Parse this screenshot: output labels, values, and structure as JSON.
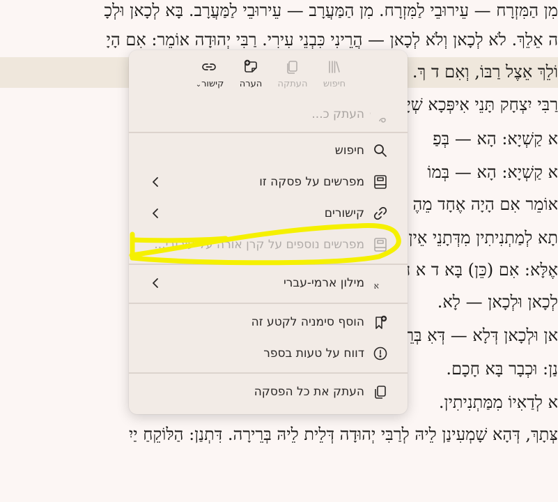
{
  "text_lines": [
    "מִן הַמִּזְרָח — עֵירוּבֵי לַמִּזְרָח. מִן הַמַּעֲרָב — עֵירוּבֵי לַמַּעֲרָב. בָּא לְכָאן וּלְכָ",
    "ה אֵלֵךְ. לֹא לְכָאן וְלֹא לְכָאן — הֲרֵינִי כִּבְנֵי עִירִי. רַבִּי יְהוּדָה אוֹמֵר: אִם הָיָ",
    "וֹלֵךְ אֵצֶל רַבּוֹ, וְאִם ד                                                 ךְ.",
    "רַבִּי יִצְחָק תָּנֵי אִיפְּכָא                                                שְׁיָא חָכָם אַחָכָם!",
    "א קַשְׁיָא: הָא — בְּפַ",
    "א קַשְׁיָא: הָא — בְּמוֹ",
    "אוֹמֵר אִם הָיָה אֶחָד מֵהֶ                                                   טְבֶרְיָה טָפֵי מֵרַבִּיה.",
    "תָא לְמַתְנִיתִין מִדְּתָנֵי                                                   אֵין אָדָם מַתְנֶה עַ",
    "אֶלָּא: אִם (כֵּן) בָּא ד                                                     א חָכָם לַמַּעֲרָב —",
    "לְכָאן וּלְכָאן — לָא.",
    "אן וּלְכָאן דְּלָא — דְּאִ                                                    בְּרֵירָה.",
    "נַן: וּכְבָר בָּא חָכָם.",
    "א לְדַאִיוֹ מִמַּתְנִיתִין.",
    "צְּתָךְ, דְּהָא שָׁמְעִינַן לֵיהּ לְרַבִּי יְהוּדָה דְּלֵית לֵיהּ בְּרֵירָה. דִּתְנַן: הַלּוֹקֵחַ יַיִ"
  ],
  "menu": {
    "toolbar": [
      {
        "label": "חיפוש",
        "icon": "library-icon",
        "disabled": true
      },
      {
        "label": "העתקה",
        "icon": "copy-icon",
        "disabled": true
      },
      {
        "label": "הערה",
        "icon": "add-note-icon",
        "disabled": false
      },
      {
        "label": "קישור",
        "icon": "link-icon",
        "disabled": false,
        "dropdown": true
      }
    ],
    "search_placeholder": "העתק כ...",
    "items": [
      {
        "label": "חיפוש",
        "icon": "search-icon",
        "arrow": false,
        "disabled": false
      },
      {
        "label": "מפרשים על פסקה זו",
        "icon": "book-icon",
        "arrow": true,
        "disabled": false
      },
      {
        "label": "קישורים",
        "icon": "link-icon",
        "arrow": true,
        "disabled": false
      },
      {
        "label": "מפרשים נוספים על קרן אורה על עירובי...",
        "icon": "book-icon",
        "arrow": false,
        "disabled": true
      },
      {
        "label": "מילון ארמי-עברי",
        "icon": "translate-icon",
        "arrow": true,
        "disabled": false
      },
      {
        "label": "הוסף סימניה לקטע זה",
        "icon": "bookmark-add-icon",
        "arrow": false,
        "disabled": false
      },
      {
        "label": "דווח על טעות בספר",
        "icon": "alert-circle-icon",
        "arrow": false,
        "disabled": false
      },
      {
        "label": "העתק את כל הפסקה",
        "icon": "copy-icon",
        "arrow": false,
        "disabled": false
      }
    ]
  },
  "colors": {
    "page_bg": "#fcf6f4",
    "highlight_line": "#efe7dc",
    "menu_bg": "#f2ebe6",
    "annotation_yellow": "#f5f000"
  }
}
